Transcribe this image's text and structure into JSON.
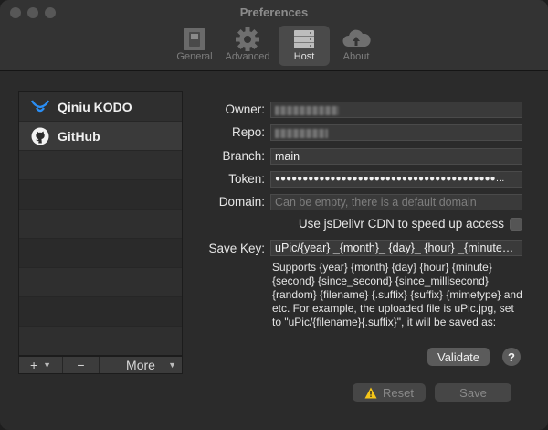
{
  "window": {
    "title": "Preferences"
  },
  "toolbar": {
    "tabs": [
      {
        "label": "General",
        "icon": "switch-icon"
      },
      {
        "label": "Advanced",
        "icon": "gear-icon"
      },
      {
        "label": "Host",
        "icon": "server-icon",
        "active": true
      },
      {
        "label": "About",
        "icon": "cloud-upload-icon"
      }
    ]
  },
  "hosts": {
    "items": [
      {
        "label": "Qiniu KODO",
        "icon": "qiniu-logo-icon"
      },
      {
        "label": "GitHub",
        "icon": "github-logo-icon",
        "selected": true
      }
    ],
    "footer": {
      "add": "+",
      "remove": "−",
      "more": "More"
    }
  },
  "form": {
    "owner_label": "Owner:",
    "repo_label": "Repo:",
    "branch_label": "Branch:",
    "branch_value": "main",
    "token_label": "Token:",
    "token_value": "●●●●●●●●●●●●●●●●●●●●●●●●●●●●●●●●●●●●●●●●…",
    "domain_label": "Domain:",
    "domain_placeholder": "Can be empty, there is a default domain",
    "cdn_label": "Use jsDelivr CDN to speed up access",
    "cdn_checked": false,
    "savekey_label": "Save Key:",
    "savekey_value": "uPic/{year} _{month}_ {day}_  {hour} _{minute…",
    "help_text": "Supports {year} {month} {day} {hour} {minute} {second} {since_second} {since_millisecond} {random} {filename} {.suffix} {suffix} {mimetype} and etc. For example, the uploaded file is uPic.jpg, set to \"uPic/{filename}{.suffix}\", it will be saved as:"
  },
  "actions": {
    "validate": "Validate",
    "help": "?",
    "reset": "Reset",
    "save": "Save"
  },
  "colors": {
    "window": "#2b2b2b",
    "titlebar": "#333333",
    "warning": "#f5c518"
  }
}
